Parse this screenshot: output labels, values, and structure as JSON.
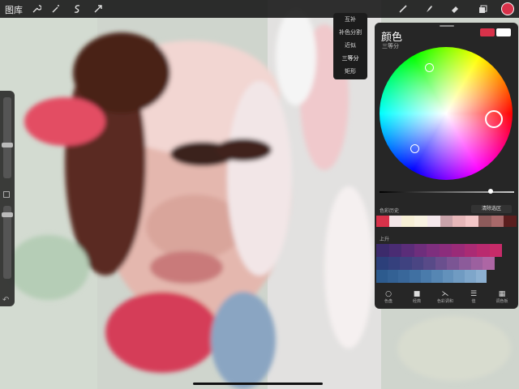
{
  "topbar": {
    "gallery_label": "图库",
    "left_tools": [
      "wrench-icon",
      "magic-wand-icon",
      "selection-icon",
      "transform-arrow-icon"
    ],
    "right_tools": [
      "brush-icon",
      "smudge-icon",
      "eraser-icon",
      "layers-icon"
    ],
    "current_color": "#d8324a"
  },
  "harmony_menu": {
    "items": [
      "互补",
      "补色分割",
      "近似",
      "三等分",
      "矩形"
    ],
    "selected": "三等分"
  },
  "color_panel": {
    "title": "颜色",
    "subtitle": "三等分",
    "primary_swatch": "#d8324a",
    "secondary_swatch": "#ffffff",
    "history_label": "色彩历史",
    "clear_label": "清除选区",
    "history_colors": [
      "#d8324a",
      "#f3e6e8",
      "#f6efd6",
      "#f8f2e2",
      "#f4e8ec",
      "#c9a3aa",
      "#e6b7b9",
      "#f4c7c8",
      "#8d5b5b",
      "#a8696a",
      "#5a1e1e"
    ],
    "palette_label": "上升",
    "palette_rows": [
      [
        "#3c2a6b",
        "#4a2c73",
        "#5b2d79",
        "#6e2e7c",
        "#7e2f7e",
        "#8c2d7c",
        "#9a2b78",
        "#aa2b74",
        "#b92a6f",
        "#c72b69"
      ],
      [
        "#2c3f7a",
        "#35407d",
        "#3f4280",
        "#4a4583",
        "#584a88",
        "#6a4f8e",
        "#7b5594",
        "#8c5b9a",
        "#9c609f",
        "#ad66a4"
      ],
      [
        "#2d5b8e",
        "#336194",
        "#39679a",
        "#4070a2",
        "#4a7bab",
        "#5686b3",
        "#6391bb",
        "#709bc2",
        "#7ea6ca",
        "#8cb0d1"
      ]
    ],
    "tabs": [
      {
        "icon": "disc-icon",
        "label": "色盘"
      },
      {
        "icon": "square-icon",
        "label": "经典"
      },
      {
        "icon": "harmony-icon",
        "label": "色彩调和"
      },
      {
        "icon": "sliders-icon",
        "label": "值"
      },
      {
        "icon": "grid-icon",
        "label": "调色板"
      }
    ]
  }
}
